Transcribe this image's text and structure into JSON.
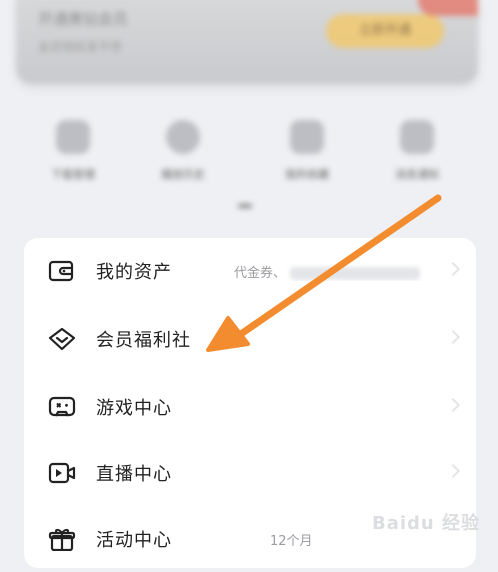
{
  "vip_banner": {
    "title": "开通黄钻会员",
    "subtitle": "会员特权享不停",
    "button": "立即开通"
  },
  "shortcuts": [
    {
      "label": "下载管理",
      "icon": "download-icon"
    },
    {
      "label": "播放历史",
      "icon": "history-icon"
    },
    {
      "label": "我的收藏",
      "icon": "collection-icon"
    },
    {
      "label": "消息通知",
      "icon": "message-icon"
    }
  ],
  "menu": {
    "items": [
      {
        "label": "我的资产",
        "extra": "代金券、",
        "icon": "wallet-icon"
      },
      {
        "label": "会员福利社",
        "extra": "",
        "icon": "diamond-icon"
      },
      {
        "label": "游戏中心",
        "extra": "",
        "icon": "gamepad-icon"
      },
      {
        "label": "直播中心",
        "extra": "",
        "icon": "live-video-icon"
      },
      {
        "label": "活动中心",
        "extra": "12个月",
        "icon": "gift-icon"
      }
    ]
  },
  "annotation": {
    "color": "#f28c2e",
    "type": "arrow"
  },
  "watermark": "Baidu 经验"
}
